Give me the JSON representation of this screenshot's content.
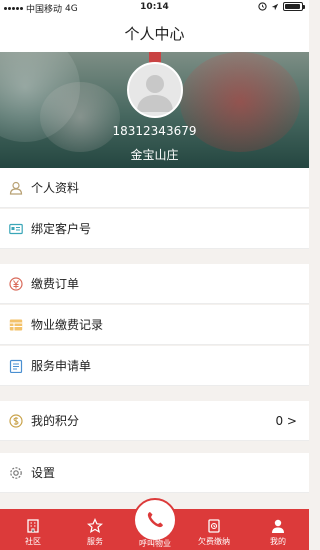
{
  "status_bar": {
    "carrier": "中国移动",
    "network": "4G",
    "time": "10:14",
    "battery_level": 0.95
  },
  "header": {
    "title": "个人中心"
  },
  "profile": {
    "phone": "18312343679",
    "community": "金宝山庄"
  },
  "menu": {
    "personal_info": "个人资料",
    "bind_customer": "绑定客户号",
    "payment_orders": "缴费订单",
    "property_fee_records": "物业缴费记录",
    "service_requests": "服务申请单",
    "my_points": "我的积分",
    "my_points_value": "0 >",
    "settings": "设置"
  },
  "tabs": {
    "community": "社区",
    "service": "服务",
    "call_property": "呼叫物业",
    "arrears_payment": "欠费缴纳",
    "mine": "我的"
  },
  "colors": {
    "accent": "#dc3a3a",
    "background": "#f4f1ee"
  }
}
